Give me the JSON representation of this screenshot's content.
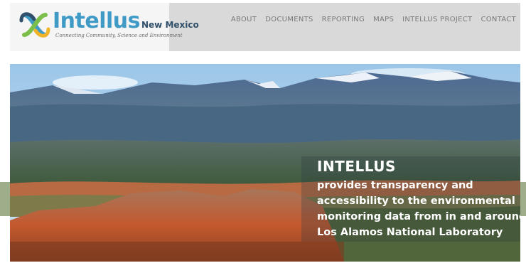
{
  "brand": {
    "name": "Intellus",
    "region": "New Mexico",
    "tagline": "Connecting Community, Science and Environment"
  },
  "nav": {
    "items": [
      "ABOUT",
      "DOCUMENTS",
      "REPORTING",
      "MAPS",
      "INTELLUS PROJECT",
      "CONTACT"
    ]
  },
  "hero": {
    "title": "INTELLUS",
    "lines": [
      "provides transparency and",
      "accessibility to the environmental",
      "monitoring data from in and around",
      "Los Alamos National Laboratory"
    ]
  },
  "colors": {
    "header_bg": "#d9d9d9",
    "logo_blue": "#3f9ac6",
    "logo_green": "#7bbf4a",
    "nav_text": "#7a7a7a",
    "side_bar": "#9fae8a"
  }
}
